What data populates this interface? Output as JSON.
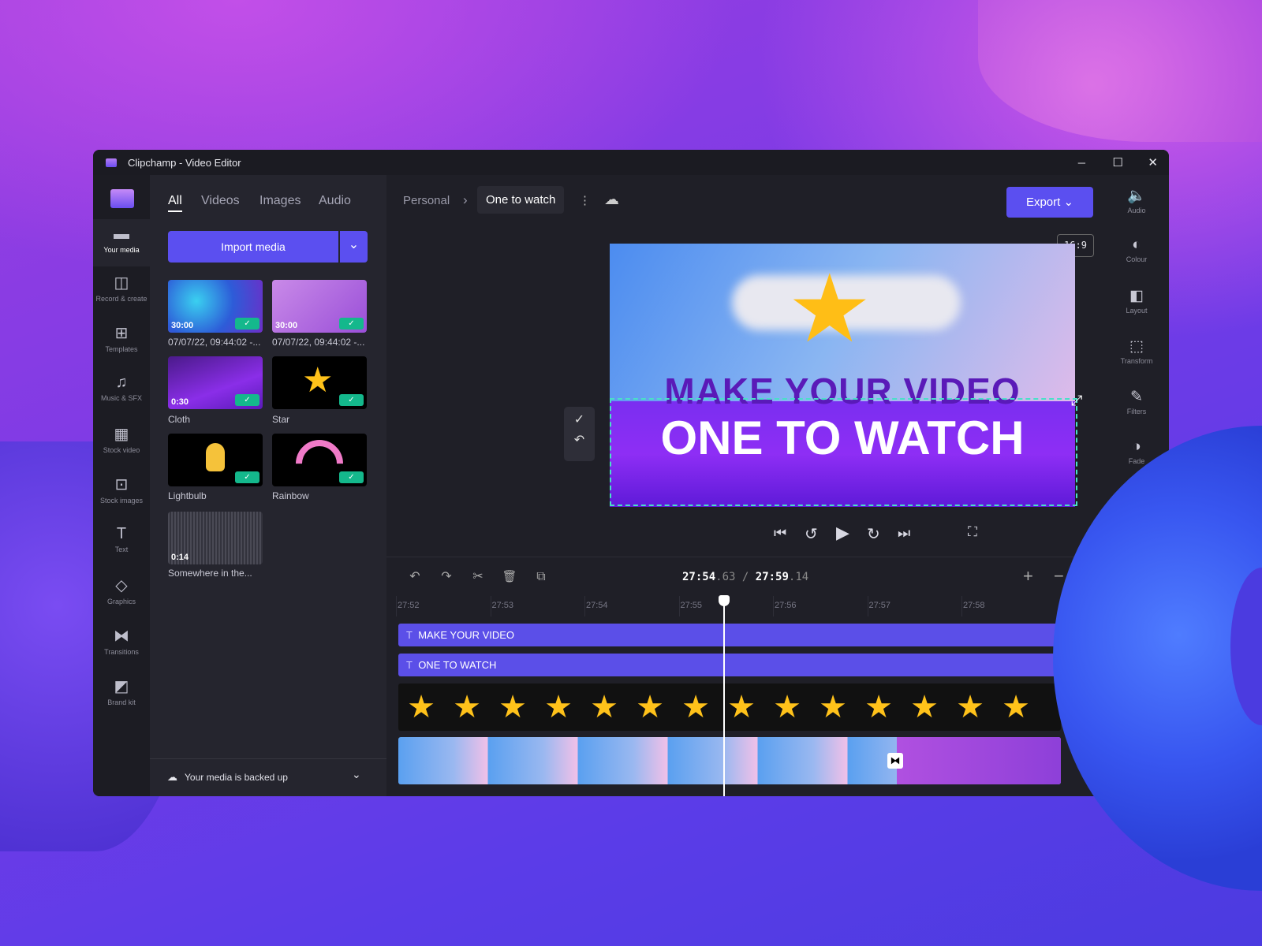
{
  "window": {
    "title": "Clipchamp - Video Editor",
    "minimize": "─",
    "maximize": "☐",
    "close": "✕"
  },
  "nav": [
    {
      "label": "Your media",
      "icon": "▬"
    },
    {
      "label": "Record & create",
      "icon": "◫"
    },
    {
      "label": "Templates",
      "icon": "⊞"
    },
    {
      "label": "Music & SFX",
      "icon": "♫"
    },
    {
      "label": "Stock video",
      "icon": "▦"
    },
    {
      "label": "Stock images",
      "icon": "⊡"
    },
    {
      "label": "Text",
      "icon": "T"
    },
    {
      "label": "Graphics",
      "icon": "◇"
    },
    {
      "label": "Transitions",
      "icon": "⧓"
    },
    {
      "label": "Brand kit",
      "icon": "◩"
    }
  ],
  "media": {
    "tabs": [
      "All",
      "Videos",
      "Images",
      "Audio"
    ],
    "import_label": "Import media",
    "dropdown": "⌄",
    "items": [
      {
        "duration": "30:00",
        "label": "07/07/22, 09:44:02 -..."
      },
      {
        "duration": "30:00",
        "label": "07/07/22, 09:44:02 -..."
      },
      {
        "duration": "0:30",
        "label": "Cloth"
      },
      {
        "duration": "",
        "label": "Star"
      },
      {
        "duration": "",
        "label": "Lightbulb"
      },
      {
        "duration": "",
        "label": "Rainbow"
      },
      {
        "duration": "0:14",
        "label": "Somewhere in the..."
      }
    ],
    "backup": "Your media is backed up"
  },
  "header": {
    "breadcrumb": "Personal",
    "separator": "›",
    "project": "One to watch",
    "more": "⋮",
    "export": "Export",
    "export_arrow": "⌄",
    "ratio": "16:9"
  },
  "preview": {
    "line1": "MAKE YOUR VIDEO",
    "line2": "ONE TO WATCH",
    "confirm": "✓",
    "undo": "↶"
  },
  "playback": {
    "prev": "⏮",
    "back5": "↺",
    "play": "▶",
    "fwd5": "↻",
    "next": "⏭",
    "fullscreen": "⛶"
  },
  "timeline": {
    "current_main": "27:54",
    "current_frac": ".63",
    "sep": "/",
    "total_main": "27:59",
    "total_frac": ".14",
    "zoom_in": "+",
    "zoom_out": "−",
    "ticks": [
      "27:52",
      "27:53",
      "27:54",
      "27:55",
      "27:56",
      "27:57",
      "27:58"
    ],
    "tracks": [
      {
        "label": "MAKE YOUR VIDEO"
      },
      {
        "label": "ONE TO WATCH"
      }
    ],
    "tools": [
      "↶",
      "↷",
      "✂",
      "🗑",
      "⧉"
    ]
  },
  "right_rail": [
    {
      "label": "Audio",
      "icon": "🔈"
    },
    {
      "label": "Colour",
      "icon": "◐"
    },
    {
      "label": "Layout",
      "icon": "◧"
    },
    {
      "label": "Transform",
      "icon": "⬚"
    },
    {
      "label": "Filters",
      "icon": "✎"
    },
    {
      "label": "Fade",
      "icon": "◑"
    }
  ],
  "colors": {
    "accent": "#5b4ff0",
    "check": "#14b88c"
  }
}
